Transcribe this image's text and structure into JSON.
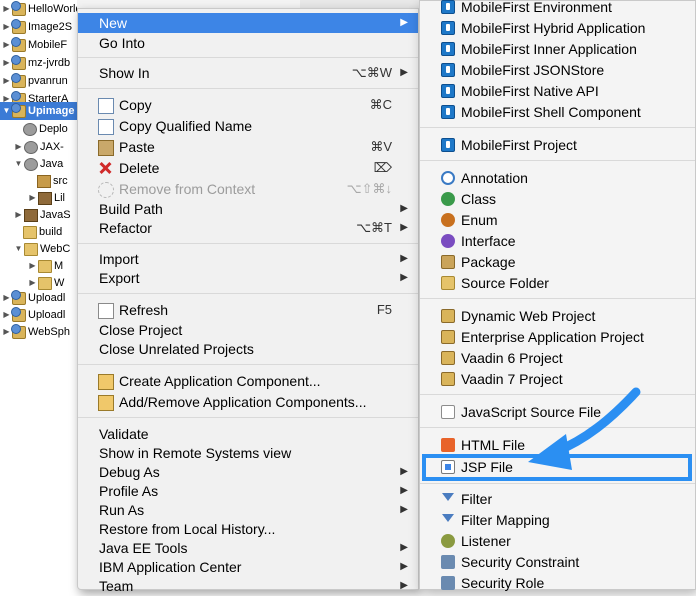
{
  "tree": {
    "items": [
      {
        "label": "HelloWorld",
        "icon": "project-icon"
      },
      {
        "label": "Image2S",
        "icon": "project-icon"
      },
      {
        "label": "MobileF",
        "icon": "project-icon"
      },
      {
        "label": "mz-jvrdb",
        "icon": "project-icon"
      },
      {
        "label": "pvanrun",
        "icon": "project-icon"
      },
      {
        "label": "StarterA",
        "icon": "project-icon"
      },
      {
        "label": "Upimage",
        "icon": "project-icon"
      },
      {
        "label": "Deplo",
        "icon": "gear-icon"
      },
      {
        "label": "JAX-",
        "icon": "gear-icon"
      },
      {
        "label": "Java",
        "icon": "gear-icon"
      },
      {
        "label": "src",
        "icon": "package-icon"
      },
      {
        "label": "Lil",
        "icon": "jar-icon"
      },
      {
        "label": "JavaS",
        "icon": "jar-icon"
      },
      {
        "label": "build",
        "icon": "folder-icon"
      },
      {
        "label": "WebC",
        "icon": "folder-icon"
      },
      {
        "label": "M",
        "icon": "folder-icon"
      },
      {
        "label": "W",
        "icon": "folder-icon"
      },
      {
        "label": "Uploadl",
        "icon": "project-icon"
      },
      {
        "label": "Uploadl",
        "icon": "project-icon"
      },
      {
        "label": "WebSph",
        "icon": "project-icon"
      }
    ]
  },
  "context_menu": {
    "items": [
      {
        "label": "New",
        "arrow": "▶"
      },
      {
        "label": "Go Into"
      },
      {
        "label": "Show In",
        "shortcut": "⌥⌘W",
        "arrow": "▶"
      },
      {
        "label": "Copy",
        "shortcut": "⌘C",
        "icon": "copy-icon"
      },
      {
        "label": "Copy Qualified Name",
        "icon": "copy-qualified-name-icon"
      },
      {
        "label": "Paste",
        "shortcut": "⌘V",
        "icon": "paste-icon"
      },
      {
        "label": "Delete",
        "shortcut": "⌦",
        "icon": "delete-icon"
      },
      {
        "label": "Remove from Context",
        "shortcut": "⌥⇧⌘↓",
        "icon": "remove-context-icon"
      },
      {
        "label": "Build Path",
        "arrow": "▶"
      },
      {
        "label": "Refactor",
        "shortcut": "⌥⌘T",
        "arrow": "▶"
      },
      {
        "label": "Import",
        "arrow": "▶"
      },
      {
        "label": "Export",
        "arrow": "▶"
      },
      {
        "label": "Refresh",
        "shortcut": "F5",
        "icon": "refresh-icon"
      },
      {
        "label": "Close Project"
      },
      {
        "label": "Close Unrelated Projects"
      },
      {
        "label": "Create Application Component...",
        "icon": "create-component-icon"
      },
      {
        "label": "Add/Remove Application Components...",
        "icon": "add-remove-components-icon"
      },
      {
        "label": "Validate"
      },
      {
        "label": "Show in Remote Systems view"
      },
      {
        "label": "Debug As",
        "arrow": "▶"
      },
      {
        "label": "Profile As",
        "arrow": "▶"
      },
      {
        "label": "Run As",
        "arrow": "▶"
      },
      {
        "label": "Restore from Local History..."
      },
      {
        "label": "Java EE Tools",
        "arrow": "▶"
      },
      {
        "label": "IBM Application Center",
        "arrow": "▶"
      },
      {
        "label": "Team",
        "arrow": "▶"
      }
    ]
  },
  "submenu": {
    "items": [
      {
        "label": "MobileFirst Environment",
        "icon": "mobilefirst-environment-icon"
      },
      {
        "label": "MobileFirst Hybrid Application",
        "icon": "mobilefirst-hybrid-icon"
      },
      {
        "label": "MobileFirst Inner Application",
        "icon": "mobilefirst-inner-icon"
      },
      {
        "label": "MobileFirst JSONStore",
        "icon": "mobilefirst-jsonstore-icon"
      },
      {
        "label": "MobileFirst Native API",
        "icon": "mobilefirst-native-icon"
      },
      {
        "label": "MobileFirst Shell Component",
        "icon": "mobilefirst-shell-icon"
      },
      {
        "label": "MobileFirst Project",
        "icon": "mobilefirst-project-icon"
      },
      {
        "label": "Annotation",
        "icon": "annotation-icon"
      },
      {
        "label": "Class",
        "icon": "class-icon"
      },
      {
        "label": "Enum",
        "icon": "enum-icon"
      },
      {
        "label": "Interface",
        "icon": "interface-icon"
      },
      {
        "label": "Package",
        "icon": "package-icon"
      },
      {
        "label": "Source Folder",
        "icon": "source-folder-icon"
      },
      {
        "label": "Dynamic Web Project",
        "icon": "dynamic-web-project-icon"
      },
      {
        "label": "Enterprise Application Project",
        "icon": "enterprise-app-icon"
      },
      {
        "label": "Vaadin 6 Project",
        "icon": "vaadin-icon"
      },
      {
        "label": "Vaadin 7 Project",
        "icon": "vaadin-icon"
      },
      {
        "label": "JavaScript Source File",
        "icon": "javascript-file-icon"
      },
      {
        "label": "HTML File",
        "icon": "html-file-icon"
      },
      {
        "label": "JSP File",
        "icon": "jsp-file-icon"
      },
      {
        "label": "Filter",
        "icon": "filter-icon"
      },
      {
        "label": "Filter Mapping",
        "icon": "filter-mapping-icon"
      },
      {
        "label": "Listener",
        "icon": "listener-icon"
      },
      {
        "label": "Security Constraint",
        "icon": "security-constraint-icon"
      },
      {
        "label": "Security Role",
        "icon": "security-role-icon"
      }
    ]
  },
  "colors": {
    "highlight": "#3d85e6",
    "annotation": "#2b8ff2",
    "selected_tree": "#3b7bd6"
  }
}
